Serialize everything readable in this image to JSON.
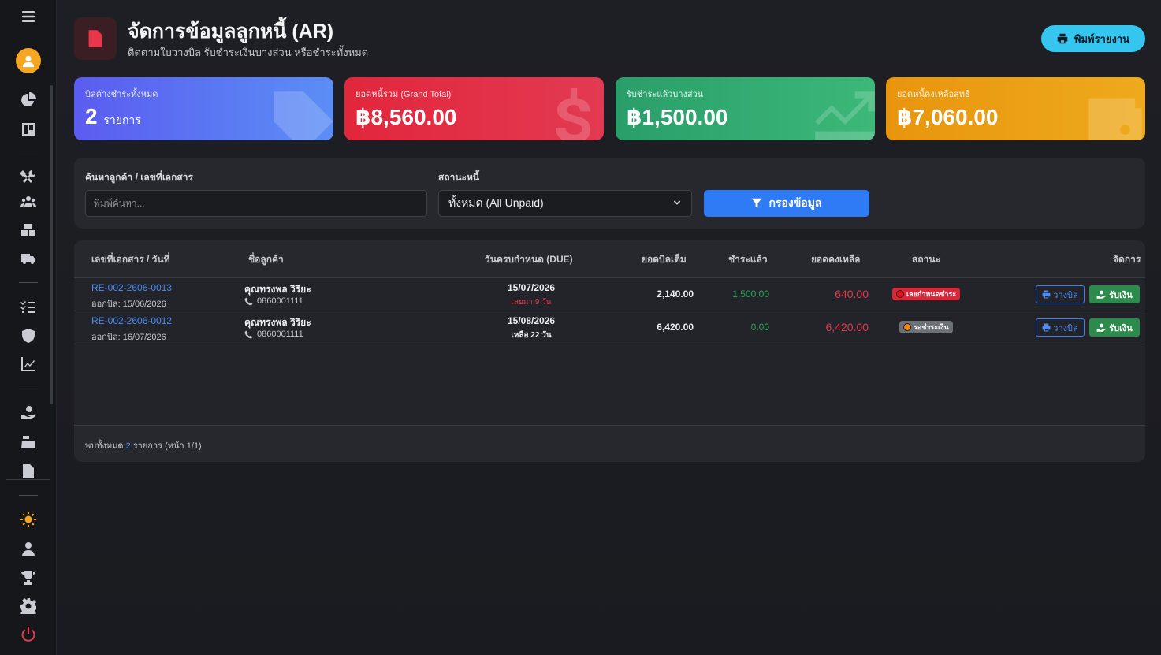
{
  "sidebar": {
    "icons": [
      "menu-icon",
      "user-avatar-icon",
      "pie-chart-icon",
      "board-icon",
      "tools-icon",
      "users-icon",
      "boxes-icon",
      "truck-icon",
      "list-check-icon",
      "shield-icon",
      "line-chart-icon",
      "hand-money-icon",
      "cash-register-icon",
      "invoice-icon",
      "settings-sun-icon",
      "user-tie-icon",
      "trophy-icon",
      "gear-icon",
      "power-icon"
    ],
    "accent_active": "#f5a623",
    "accent_power": "#e23a4d"
  },
  "header": {
    "title": "จัดการข้อมูลลูกหนี้ (AR)",
    "subtitle": "ติดตามใบวางบิล รับชำระเงินบางส่วน หรือชำระทั้งหมด",
    "print_label": "พิมพ์รายงาน"
  },
  "cards": [
    {
      "label": "บิลค้างชำระทั้งหมด",
      "value": "2",
      "unit": "รายการ",
      "color": "#5b5cf0"
    },
    {
      "label": "ยอดหนี้รวม (Grand Total)",
      "value": "฿8,560.00",
      "color": "#e2263c"
    },
    {
      "label": "รับชำระแล้วบางส่วน",
      "value": "฿1,500.00",
      "color": "#2a9e6a"
    },
    {
      "label": "ยอดหนี้คงเหลือสุทธิ",
      "value": "฿7,060.00",
      "color": "#e8950e"
    }
  ],
  "filter": {
    "search_label": "ค้นหาลูกค้า / เลขที่เอกสาร",
    "search_placeholder": "พิมพ์ค้นหา...",
    "status_label": "สถานะหนี้",
    "status_selected": "ทั้งหมด (All Unpaid)",
    "button_label": "กรองข้อมูล"
  },
  "table": {
    "headers": [
      "เลขที่เอกสาร / วันที่",
      "ชื่อลูกค้า",
      "วันครบกำหนด (DUE)",
      "ยอดบิลเต็ม",
      "ชำระแล้ว",
      "ยอดคงเหลือ",
      "สถานะ",
      "จัดการ"
    ],
    "rows": [
      {
        "doc_no": "RE-002-2606-0013",
        "issued": "ออกบิล: 15/06/2026",
        "customer": "คุณทรงพล วิริยะ",
        "phone": "0860001111",
        "due_date": "15/07/2026",
        "due_note": "เลยมา 9 วัน",
        "due_note_color": "#e23a4d",
        "total": "2,140.00",
        "paid": "1,500.00",
        "balance": "640.00",
        "status": "เลยกำหนดชำระ",
        "status_bg": "#d8263a",
        "status_dot": "#e8101f",
        "bill_btn": "วางบิล",
        "pay_btn": "รับเงิน"
      },
      {
        "doc_no": "RE-002-2606-0012",
        "issued": "ออกบิล: 16/07/2026",
        "customer": "คุณทรงพล วิริยะ",
        "phone": "0860001111",
        "due_date": "15/08/2026",
        "due_note": "เหลือ 22 วัน",
        "due_note_color": "#eef0f3",
        "total": "6,420.00",
        "paid": "0.00",
        "balance": "6,420.00",
        "status": "รอชำระเงิน",
        "status_bg": "#6c7077",
        "status_dot": "#f08a16",
        "bill_btn": "วางบิล",
        "pay_btn": "รับเงิน"
      }
    ],
    "footer_prefix": "พบทั้งหมด",
    "footer_count": "2",
    "footer_suffix": "รายการ (หน้า 1/1)"
  }
}
